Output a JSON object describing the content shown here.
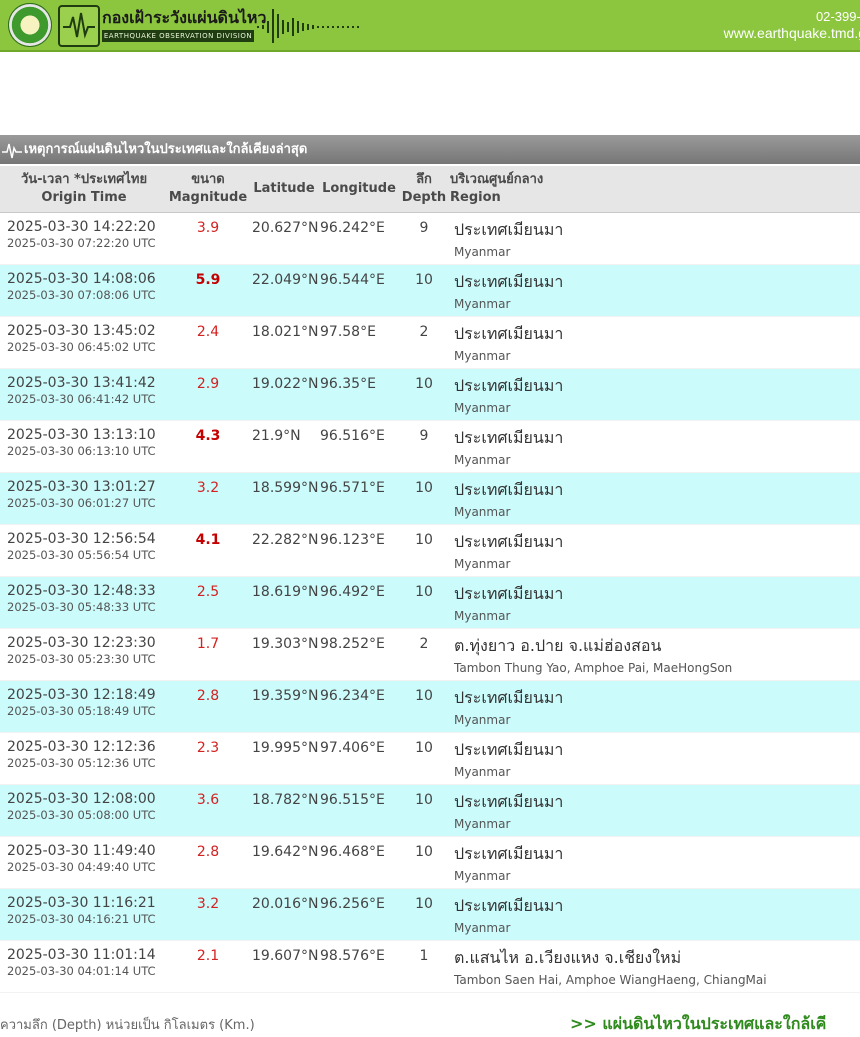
{
  "header": {
    "brand_th": "กองเฝ้าระวังแผ่นดินไหว",
    "brand_en": "EARTHQUAKE OBSERVATION DIVISION",
    "phone": "02-399-4",
    "website": "www.earthquake.tmd.g",
    "colors": {
      "bar": "#8cc63f",
      "text": "#ffffff"
    },
    "icons": [
      "seal-logo-icon",
      "seismograph-wave-icon"
    ]
  },
  "section": {
    "title": "เหตุการณ์แผ่นดินไหวในประเทศและใกล้เคียงล่าสุด"
  },
  "table": {
    "headers": {
      "time_th": "วัน-เวลา *ประเทศไทย",
      "time_en": "Origin Time",
      "mag_th": "ขนาด",
      "mag_en": "Magnitude",
      "lat": "Latitude",
      "lon": "Longitude",
      "depth_th": "ลึก",
      "depth_en": "Depth",
      "region_th": "บริเวณศูนย์กลาง",
      "region_en": "Region"
    },
    "rows": [
      {
        "time": "2025-03-30 14:22:20",
        "utc": "2025-03-30 07:22:20 UTC",
        "mag": "3.9",
        "lat": "20.627°N",
        "lon": "96.242°E",
        "depth": "9",
        "region_th": "ประเทศเมียนมา",
        "region_en": "Myanmar"
      },
      {
        "time": "2025-03-30 14:08:06",
        "utc": "2025-03-30 07:08:06 UTC",
        "mag": "5.9",
        "lat": "22.049°N",
        "lon": "96.544°E",
        "depth": "10",
        "region_th": "ประเทศเมียนมา",
        "region_en": "Myanmar"
      },
      {
        "time": "2025-03-30 13:45:02",
        "utc": "2025-03-30 06:45:02 UTC",
        "mag": "2.4",
        "lat": "18.021°N",
        "lon": "97.58°E",
        "depth": "2",
        "region_th": "ประเทศเมียนมา",
        "region_en": "Myanmar"
      },
      {
        "time": "2025-03-30 13:41:42",
        "utc": "2025-03-30 06:41:42 UTC",
        "mag": "2.9",
        "lat": "19.022°N",
        "lon": "96.35°E",
        "depth": "10",
        "region_th": "ประเทศเมียนมา",
        "region_en": "Myanmar"
      },
      {
        "time": "2025-03-30 13:13:10",
        "utc": "2025-03-30 06:13:10 UTC",
        "mag": "4.3",
        "lat": "21.9°N",
        "lon": "96.516°E",
        "depth": "9",
        "region_th": "ประเทศเมียนมา",
        "region_en": "Myanmar"
      },
      {
        "time": "2025-03-30 13:01:27",
        "utc": "2025-03-30 06:01:27 UTC",
        "mag": "3.2",
        "lat": "18.599°N",
        "lon": "96.571°E",
        "depth": "10",
        "region_th": "ประเทศเมียนมา",
        "region_en": "Myanmar"
      },
      {
        "time": "2025-03-30 12:56:54",
        "utc": "2025-03-30 05:56:54 UTC",
        "mag": "4.1",
        "lat": "22.282°N",
        "lon": "96.123°E",
        "depth": "10",
        "region_th": "ประเทศเมียนมา",
        "region_en": "Myanmar"
      },
      {
        "time": "2025-03-30 12:48:33",
        "utc": "2025-03-30 05:48:33 UTC",
        "mag": "2.5",
        "lat": "18.619°N",
        "lon": "96.492°E",
        "depth": "10",
        "region_th": "ประเทศเมียนมา",
        "region_en": "Myanmar"
      },
      {
        "time": "2025-03-30 12:23:30",
        "utc": "2025-03-30 05:23:30 UTC",
        "mag": "1.7",
        "lat": "19.303°N",
        "lon": "98.252°E",
        "depth": "2",
        "region_th": "ต.ทุ่งยาว อ.ปาย จ.แม่ฮ่องสอน",
        "region_en": "Tambon Thung Yao, Amphoe Pai, MaeHongSon"
      },
      {
        "time": "2025-03-30 12:18:49",
        "utc": "2025-03-30 05:18:49 UTC",
        "mag": "2.8",
        "lat": "19.359°N",
        "lon": "96.234°E",
        "depth": "10",
        "region_th": "ประเทศเมียนมา",
        "region_en": "Myanmar"
      },
      {
        "time": "2025-03-30 12:12:36",
        "utc": "2025-03-30 05:12:36 UTC",
        "mag": "2.3",
        "lat": "19.995°N",
        "lon": "97.406°E",
        "depth": "10",
        "region_th": "ประเทศเมียนมา",
        "region_en": "Myanmar"
      },
      {
        "time": "2025-03-30 12:08:00",
        "utc": "2025-03-30 05:08:00 UTC",
        "mag": "3.6",
        "lat": "18.782°N",
        "lon": "96.515°E",
        "depth": "10",
        "region_th": "ประเทศเมียนมา",
        "region_en": "Myanmar"
      },
      {
        "time": "2025-03-30 11:49:40",
        "utc": "2025-03-30 04:49:40 UTC",
        "mag": "2.8",
        "lat": "19.642°N",
        "lon": "96.468°E",
        "depth": "10",
        "region_th": "ประเทศเมียนมา",
        "region_en": "Myanmar"
      },
      {
        "time": "2025-03-30 11:16:21",
        "utc": "2025-03-30 04:16:21 UTC",
        "mag": "3.2",
        "lat": "20.016°N",
        "lon": "96.256°E",
        "depth": "10",
        "region_th": "ประเทศเมียนมา",
        "region_en": "Myanmar"
      },
      {
        "time": "2025-03-30 11:01:14",
        "utc": "2025-03-30 04:01:14 UTC",
        "mag": "2.1",
        "lat": "19.607°N",
        "lon": "98.576°E",
        "depth": "1",
        "region_th": "ต.แสนไห อ.เวียงแหง จ.เชียงใหม่",
        "region_en": "Tambon Saen Hai, Amphoe WiangHaeng, ChiangMai"
      }
    ],
    "strong_magnitudes": [
      "5.9",
      "4.3",
      "4.1"
    ],
    "colors": {
      "alt_row": "#ccfbfb",
      "magnitude": "#d42121",
      "header_bg": "#e6e6e6"
    }
  },
  "footer": {
    "note": "ความลึก (Depth) หน่วยเป็น กิโลเมตร (Km.)",
    "link": ">> แผ่นดินไหวในประเทศและใกล้เคี"
  }
}
